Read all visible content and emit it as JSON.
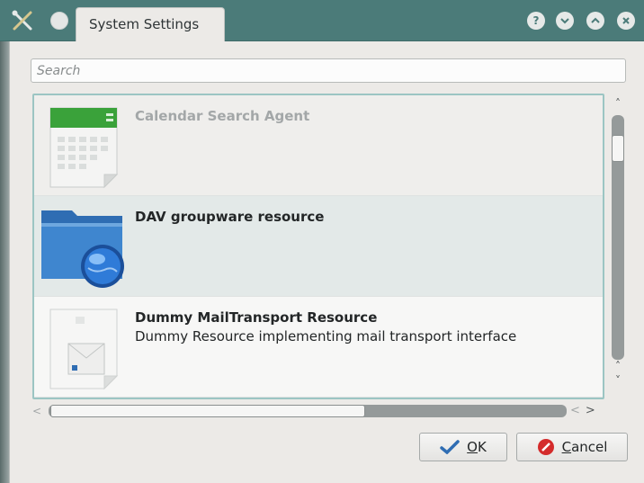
{
  "titlebar": {
    "title": "System Settings",
    "app_icon": "tools-icon",
    "buttons": [
      "help-icon",
      "minimize-icon",
      "maximize-icon",
      "close-icon"
    ]
  },
  "search": {
    "placeholder": "Search",
    "value": ""
  },
  "list": {
    "items": [
      {
        "name": "Calendar Search Agent",
        "description": "",
        "icon": "calendar-icon",
        "state": "disabled"
      },
      {
        "name": "DAV groupware resource",
        "description": "",
        "icon": "network-folder-icon",
        "state": "selected"
      },
      {
        "name": "Dummy MailTransport Resource",
        "description": "Dummy Resource implementing mail transport interface",
        "icon": "mail-document-icon",
        "state": "normal"
      }
    ]
  },
  "buttons": {
    "ok": {
      "mnemonic": "O",
      "rest": "K"
    },
    "cancel": {
      "mnemonic": "C",
      "rest": "ancel"
    }
  },
  "colors": {
    "titlebar": "#4b7b79",
    "selection": "#e3e9e8",
    "focus_border": "#9cc5c3"
  }
}
